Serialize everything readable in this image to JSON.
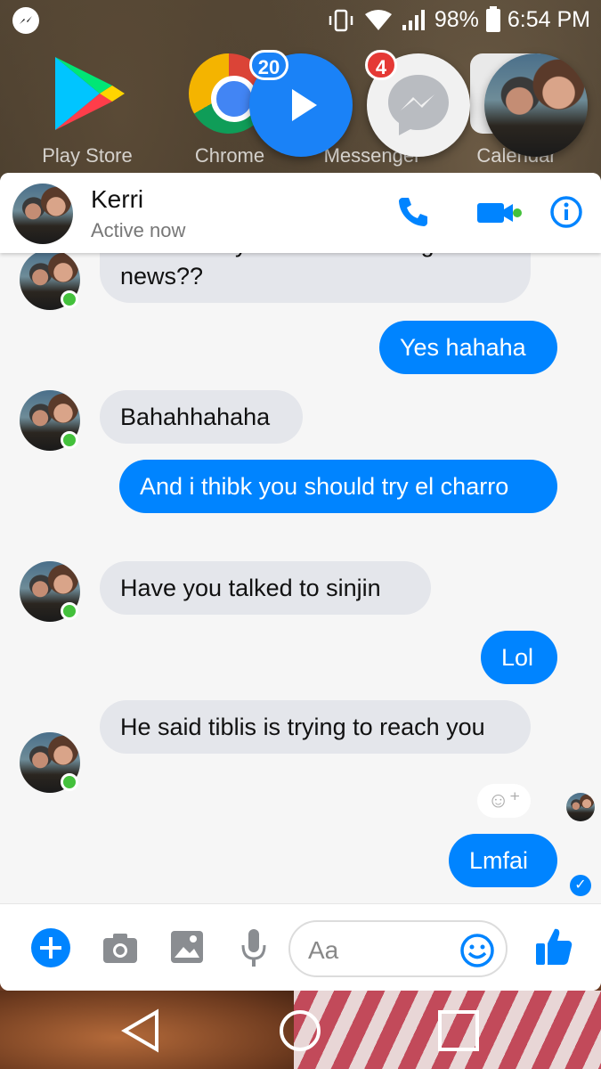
{
  "status_bar": {
    "battery": "98%",
    "time": "6:54 PM"
  },
  "launcher": {
    "apps": [
      {
        "label": "Play Store"
      },
      {
        "label": "Chrome"
      },
      {
        "label": "Messenger"
      },
      {
        "label": "Calendar"
      }
    ]
  },
  "chat_heads": {
    "play_badge": "20",
    "messenger_badge": "4"
  },
  "header": {
    "name": "Kerri",
    "status": "Active now"
  },
  "messages": [
    {
      "from": "Kerri",
      "text": "Is this really the mind blowing news??"
    },
    {
      "from": "me",
      "text": "Yes hahaha"
    },
    {
      "from": "Kerri",
      "text": "Bahahhahaha"
    },
    {
      "from": "me",
      "text": "And i thibk you should try el charro"
    },
    {
      "from": "Kerri",
      "text": "Have you talked to sinjin"
    },
    {
      "from": "me",
      "text": "Lol"
    },
    {
      "from": "Kerri",
      "text": "He said tiblis is trying to reach you"
    },
    {
      "from": "me",
      "text": "Lmfai"
    }
  ],
  "composer": {
    "placeholder": "Aa"
  },
  "colors": {
    "messenger_blue": "#0084ff",
    "incoming_bubble": "#e4e6eb",
    "online_green": "#44c13c"
  }
}
